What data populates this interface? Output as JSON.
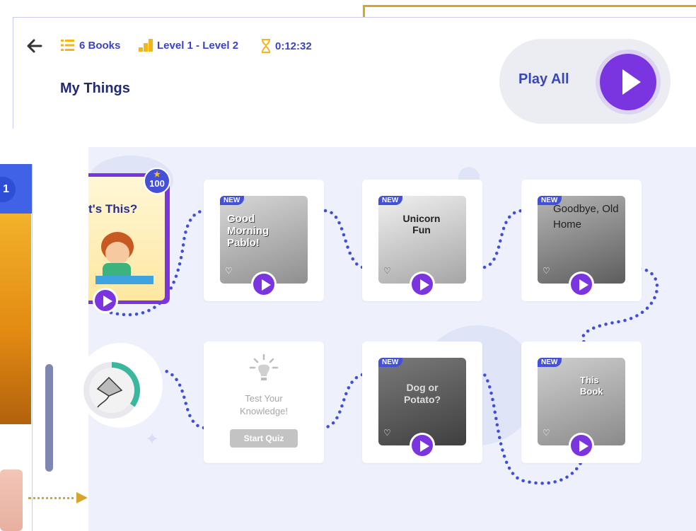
{
  "header": {
    "books": "6 Books",
    "level": "Level 1 - Level 2",
    "time": "0:12:32",
    "title": "My Things",
    "play_all": "Play All"
  },
  "left_panel": {
    "badge": "1"
  },
  "featured": {
    "title": "t's This?",
    "stars": "100"
  },
  "books": [
    {
      "title": "Good Morning Pablo!",
      "tag": "NEW"
    },
    {
      "title": "Unicorn Fun",
      "tag": "NEW"
    },
    {
      "title": "Goodbye, Old Home",
      "tag": "NEW"
    },
    {
      "title": "Dog or Potato?",
      "tag": "NEW"
    },
    {
      "title": "This Book",
      "tag": "NEW"
    }
  ],
  "quiz": {
    "heading": "Test Your Knowledge!",
    "button": "Start Quiz"
  },
  "colors": {
    "accent": "#7b35e0",
    "brand": "#3b43c4",
    "annotation": "#d6a62a",
    "map_bg": "#eef1fb"
  }
}
